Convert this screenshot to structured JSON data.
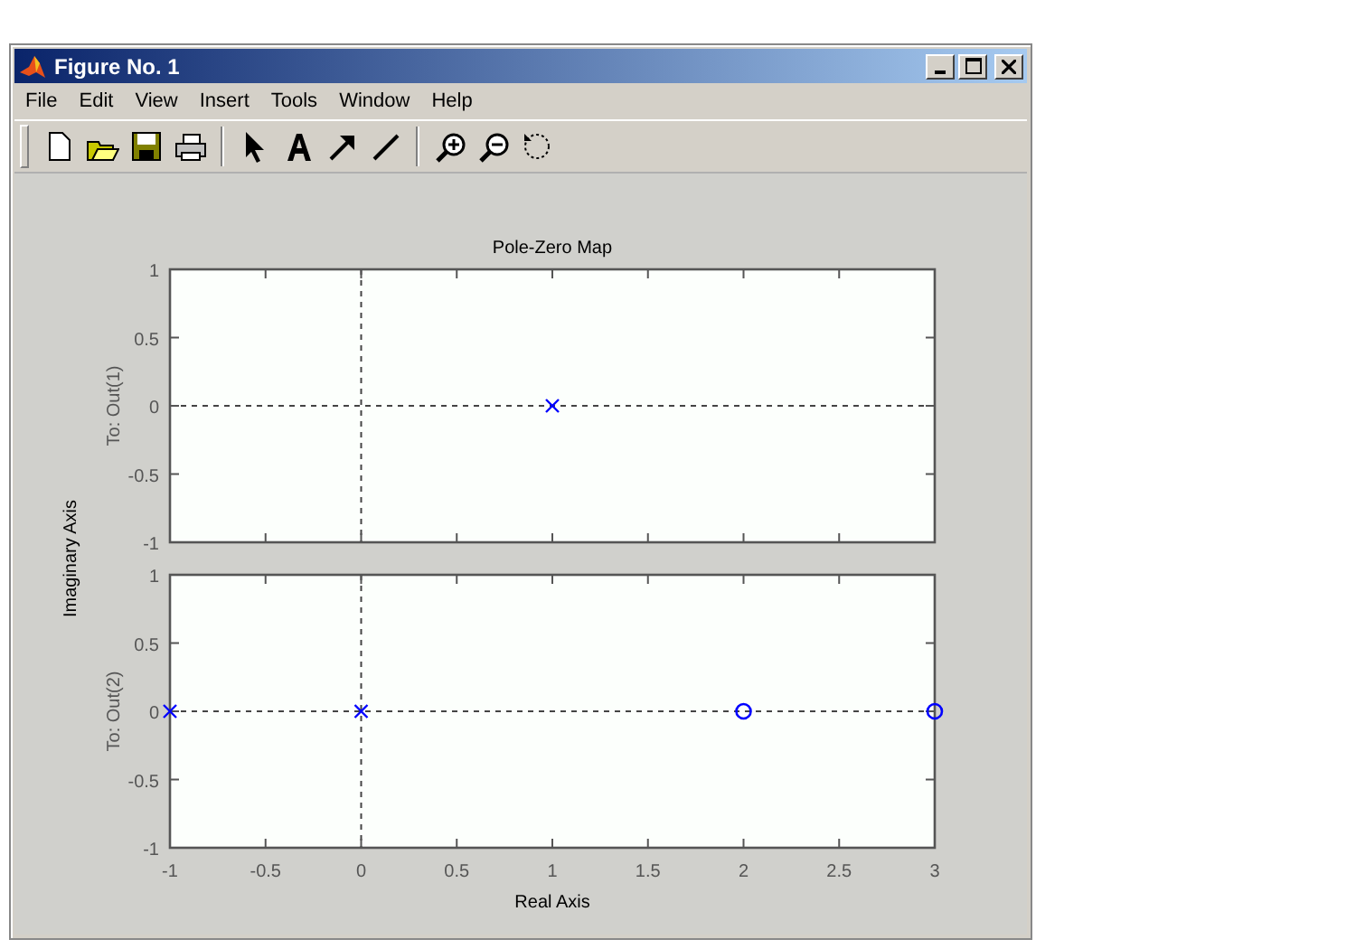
{
  "window": {
    "title": "Figure No. 1"
  },
  "menu": [
    "File",
    "Edit",
    "View",
    "Insert",
    "Tools",
    "Window",
    "Help"
  ],
  "figure": {
    "title": "Pole-Zero Map",
    "ylabel": "Imaginary Axis",
    "xlabel": "Real Axis",
    "plots": [
      {
        "ylabel": "To: Out(1)",
        "chart_data": {
          "type": "scatter",
          "xlim": [
            -1,
            3
          ],
          "ylim": [
            -1,
            1
          ],
          "yticks": [
            -1,
            -0.5,
            0,
            0.5,
            1
          ],
          "series": [
            {
              "color": "#0000ff",
              "x": [
                1
              ],
              "values": [
                0
              ]
            }
          ]
        }
      },
      {
        "ylabel": "To: Out(2)",
        "chart_data": {
          "type": "scatter",
          "xlim": [
            -1,
            3
          ],
          "ylim": [
            -1,
            1
          ],
          "xticks": [
            -1,
            -0.5,
            0,
            0.5,
            1,
            1.5,
            2,
            2.5,
            3
          ],
          "yticks": [
            -1,
            -0.5,
            0,
            0.5,
            1
          ],
          "series": [
            {
              "color": "#0000ff",
              "x": [
                -1,
                0
              ],
              "values": [
                0,
                0
              ]
            },
            {
              "color": "#0000ff",
              "x": [
                2,
                3
              ],
              "values": [
                0,
                0
              ]
            }
          ]
        }
      }
    ]
  }
}
